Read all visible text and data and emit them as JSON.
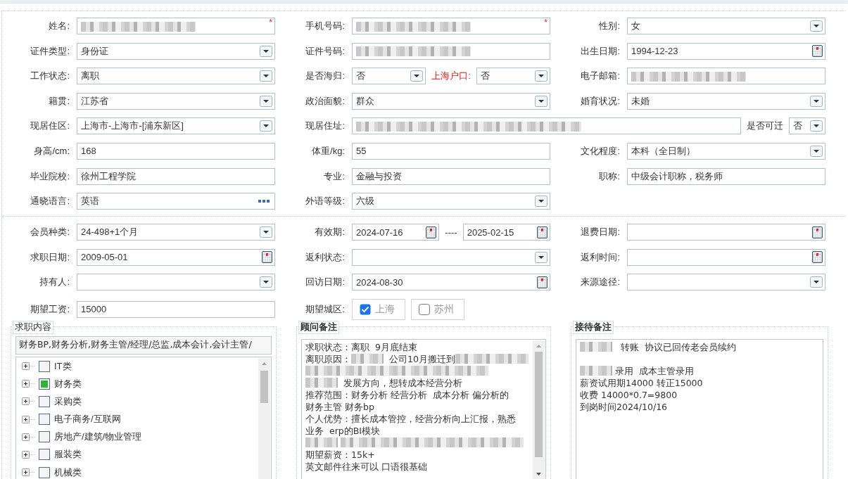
{
  "sections": [
    {
      "rows": [
        {
          "cells": [
            {
              "label": "姓名:",
              "fields": [
                {
                  "kind": "text",
                  "redacted": true,
                  "marker": "*"
                }
              ]
            },
            {
              "label": "手机号码:",
              "fields": [
                {
                  "kind": "text",
                  "redacted": true,
                  "marker": "*"
                }
              ]
            },
            {
              "label": "性别:",
              "fields": [
                {
                  "kind": "select",
                  "value": "女"
                }
              ]
            }
          ]
        },
        {
          "cells": [
            {
              "label": "证件类型:",
              "fields": [
                {
                  "kind": "select",
                  "value": "身份证"
                }
              ]
            },
            {
              "label": "证件号码:",
              "fields": [
                {
                  "kind": "text",
                  "redacted": true
                }
              ]
            },
            {
              "label": "出生日期:",
              "fields": [
                {
                  "kind": "date",
                  "value": "1994-12-23"
                }
              ]
            }
          ]
        },
        {
          "cells": [
            {
              "label": "工作状态:",
              "fields": [
                {
                  "kind": "select",
                  "value": "离职"
                }
              ]
            },
            {
              "label": "是否海归:",
              "fields": [
                {
                  "kind": "select",
                  "value": "否"
                },
                {
                  "kind": "label",
                  "text": "上海户口:",
                  "warning": true
                },
                {
                  "kind": "select",
                  "value": "否"
                }
              ]
            },
            {
              "label": "电子邮箱:",
              "fields": [
                {
                  "kind": "text",
                  "redacted": true
                }
              ]
            }
          ]
        },
        {
          "cells": [
            {
              "label": "籍贯:",
              "fields": [
                {
                  "kind": "select",
                  "value": "江苏省"
                }
              ]
            },
            {
              "label": "政治面貌:",
              "fields": [
                {
                  "kind": "select",
                  "value": "群众"
                }
              ]
            },
            {
              "label": "婚育状况:",
              "fields": [
                {
                  "kind": "select",
                  "value": "未婚"
                }
              ]
            }
          ]
        },
        {
          "cells": [
            {
              "label": "现居住区:",
              "fields": [
                {
                  "kind": "select",
                  "value": " 上海市-上海市-[浦东新区]"
                }
              ]
            },
            {
              "label": "现居住址:",
              "wide": true,
              "fields": [
                {
                  "kind": "text",
                  "redacted": true
                },
                {
                  "kind": "label",
                  "text": "是否可迁",
                  "warning": false
                },
                {
                  "kind": "select",
                  "value": "否",
                  "compact": true
                }
              ]
            }
          ]
        },
        {
          "cells": [
            {
              "label": "身高/cm:",
              "fields": [
                {
                  "kind": "text",
                  "value": "168"
                }
              ]
            },
            {
              "label": "体重/kg:",
              "fields": [
                {
                  "kind": "text",
                  "value": "55"
                }
              ]
            },
            {
              "label": "文化程度:",
              "fields": [
                {
                  "kind": "select",
                  "value": "本科（全日制）"
                }
              ]
            }
          ]
        },
        {
          "cells": [
            {
              "label": "毕业院校:",
              "fields": [
                {
                  "kind": "text",
                  "value": "徐州工程学院"
                }
              ]
            },
            {
              "label": "专业:",
              "fields": [
                {
                  "kind": "text",
                  "value": "金融与投资"
                }
              ]
            },
            {
              "label": "职称:",
              "fields": [
                {
                  "kind": "text",
                  "value": "中级会计职称，税务师"
                }
              ]
            }
          ]
        },
        {
          "cells": [
            {
              "label": "通晓语言:",
              "fields": [
                {
                  "kind": "lookup",
                  "value": "英语"
                }
              ]
            },
            {
              "label": "外语等级:",
              "fields": [
                {
                  "kind": "select",
                  "value": "六级"
                }
              ]
            }
          ]
        }
      ]
    },
    {
      "rows": [
        {
          "cells": [
            {
              "label": "会员种类:",
              "fields": [
                {
                  "kind": "select",
                  "value": " 24-498+1个月"
                }
              ]
            },
            {
              "label": "有效期:",
              "fields": [
                {
                  "kind": "date",
                  "value": "2024-07-16"
                },
                {
                  "kind": "label",
                  "text": "----",
                  "warning": false
                },
                {
                  "kind": "date",
                  "value": "2025-02-15"
                }
              ]
            },
            {
              "label": "退费日期:",
              "fields": [
                {
                  "kind": "date"
                }
              ]
            }
          ]
        },
        {
          "cells": [
            {
              "label": "求职日期:",
              "fields": [
                {
                  "kind": "date",
                  "value": "2009-05-01"
                }
              ]
            },
            {
              "label": "返利状态:",
              "fields": [
                {
                  "kind": "select"
                }
              ]
            },
            {
              "label": "返利时间:",
              "fields": [
                {
                  "kind": "date"
                }
              ]
            }
          ]
        },
        {
          "cells": [
            {
              "label": "持有人:",
              "fields": [
                {
                  "kind": "select"
                }
              ]
            },
            {
              "label": "回访日期:",
              "fields": [
                {
                  "kind": "date",
                  "value": "2024-08-30"
                }
              ]
            },
            {
              "label": "来源途径:",
              "fields": [
                {
                  "kind": "select"
                }
              ]
            }
          ]
        },
        {
          "cells": [
            {
              "label": "期望工资:",
              "fields": [
                {
                  "kind": "text",
                  "value": "15000"
                }
              ]
            },
            {
              "label": "期望城区:",
              "fields": [
                {
                  "kind": "check",
                  "text": "上海",
                  "checked": true
                },
                {
                  "kind": "check",
                  "text": "苏州",
                  "checked": false
                }
              ]
            }
          ]
        }
      ]
    }
  ],
  "job_content": {
    "legend": "求职内容",
    "emphasis": false,
    "value": "财务BP,财务分析,财务主管/经理/总监,成本会计,会计主管/",
    "tree": [
      {
        "label": "IT类",
        "checked": false,
        "expanded": false
      },
      {
        "label": "财务类",
        "checked": true,
        "expanded": false
      },
      {
        "label": "采购类",
        "checked": false,
        "expanded": false
      },
      {
        "label": "电子商务/互联网",
        "checked": false,
        "expanded": false
      },
      {
        "label": "房地产/建筑/物业管理",
        "checked": false,
        "expanded": false
      },
      {
        "label": "服装类",
        "checked": false,
        "expanded": false
      },
      {
        "label": "机械类",
        "checked": false,
        "expanded": false
      }
    ]
  },
  "notes": [
    {
      "legend": "顾问备注",
      "emphasis": true,
      "scrollbar": true,
      "lines": [
        {
          "parts": [
            {
              "kind": "text",
              "text": "求职状态：离职  9月底结束"
            }
          ]
        },
        {
          "parts": [
            {
              "kind": "text",
              "text": "离职原因："
            },
            {
              "kind": "blur"
            },
            {
              "kind": "text",
              "text": " 公司10月搬迁到"
            },
            {
              "kind": "blur"
            }
          ]
        },
        {
          "parts": [
            {
              "kind": "blur"
            }
          ]
        },
        {
          "parts": [
            {
              "kind": "blur"
            },
            {
              "kind": "text",
              "text": " 发展方向，想转成本经营分析"
            }
          ]
        },
        {
          "parts": [
            {
              "kind": "text",
              "text": "推荐范围：财务分析 经营分析  成本分析 偏分析的"
            }
          ]
        },
        {
          "parts": [
            {
              "kind": "text",
              "text": "财务主管 财务bp"
            }
          ]
        },
        {
          "parts": [
            {
              "kind": "text",
              "text": "个人优势：擅长成本管控，经营分析向上汇报，熟悉"
            }
          ]
        },
        {
          "parts": [
            {
              "kind": "text",
              "text": "业务  erp的BI模块"
            }
          ]
        },
        {
          "parts": [
            {
              "kind": "blur"
            },
            {
              "kind": "blur"
            }
          ]
        },
        {
          "parts": [
            {
              "kind": "text",
              "text": "期望薪资：15k+"
            }
          ]
        },
        {
          "parts": [
            {
              "kind": "text",
              "text": "英文邮件往来可以 口语很基础"
            }
          ]
        }
      ]
    },
    {
      "legend": "接待备注",
      "emphasis": true,
      "scrollbar": false,
      "lines": [
        {
          "kind": "text",
          "parts": [
            {
              "kind": "blur"
            },
            {
              "kind": "text",
              "text": "  转账  协议已回传老会员续约"
            }
          ]
        },
        {
          "kind": "blank"
        },
        {
          "kind": "text",
          "parts": [
            {
              "kind": "blur"
            },
            {
              "kind": "text",
              "text": "录用  成本主管录用"
            }
          ]
        },
        {
          "kind": "text",
          "parts": [
            {
              "kind": "text",
              "text": "薪资试用期14000 转正15000"
            }
          ]
        },
        {
          "kind": "text",
          "parts": [
            {
              "kind": "text",
              "text": "收费 14000*0.7=9800"
            }
          ]
        },
        {
          "kind": "text",
          "parts": [
            {
              "kind": "text",
              "text": "到岗时间2024/10/16"
            }
          ]
        }
      ]
    }
  ]
}
